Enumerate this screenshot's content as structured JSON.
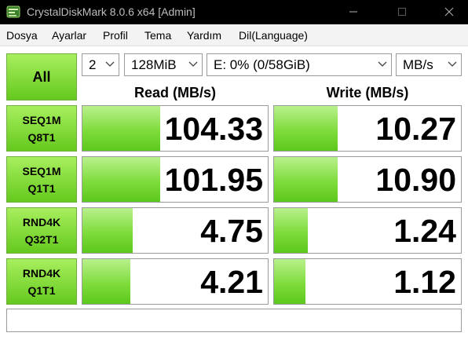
{
  "window": {
    "title": "CrystalDiskMark 8.0.6 x64 [Admin]"
  },
  "menu": {
    "items": [
      "Dosya",
      "Ayarlar",
      "Profil",
      "Tema",
      "Yardım",
      "Dil(Language)"
    ]
  },
  "controls": {
    "all_label": "All",
    "count": "2",
    "size": "128MiB",
    "drive": "E: 0% (0/58GiB)",
    "unit": "MB/s"
  },
  "headers": {
    "read": "Read (MB/s)",
    "write": "Write (MB/s)"
  },
  "tests": [
    {
      "line1": "SEQ1M",
      "line2": "Q8T1",
      "read": "104.33",
      "write": "10.27",
      "read_fill": 0.42,
      "write_fill": 0.34
    },
    {
      "line1": "SEQ1M",
      "line2": "Q1T1",
      "read": "101.95",
      "write": "10.90",
      "read_fill": 0.42,
      "write_fill": 0.34
    },
    {
      "line1": "RND4K",
      "line2": "Q32T1",
      "read": "4.75",
      "write": "1.24",
      "read_fill": 0.27,
      "write_fill": 0.18
    },
    {
      "line1": "RND4K",
      "line2": "Q1T1",
      "read": "4.21",
      "write": "1.12",
      "read_fill": 0.26,
      "write_fill": 0.17
    }
  ],
  "status": {
    "comment": ""
  },
  "colors": {
    "accent_green": "#65c91d",
    "titlebar": "#000000"
  }
}
